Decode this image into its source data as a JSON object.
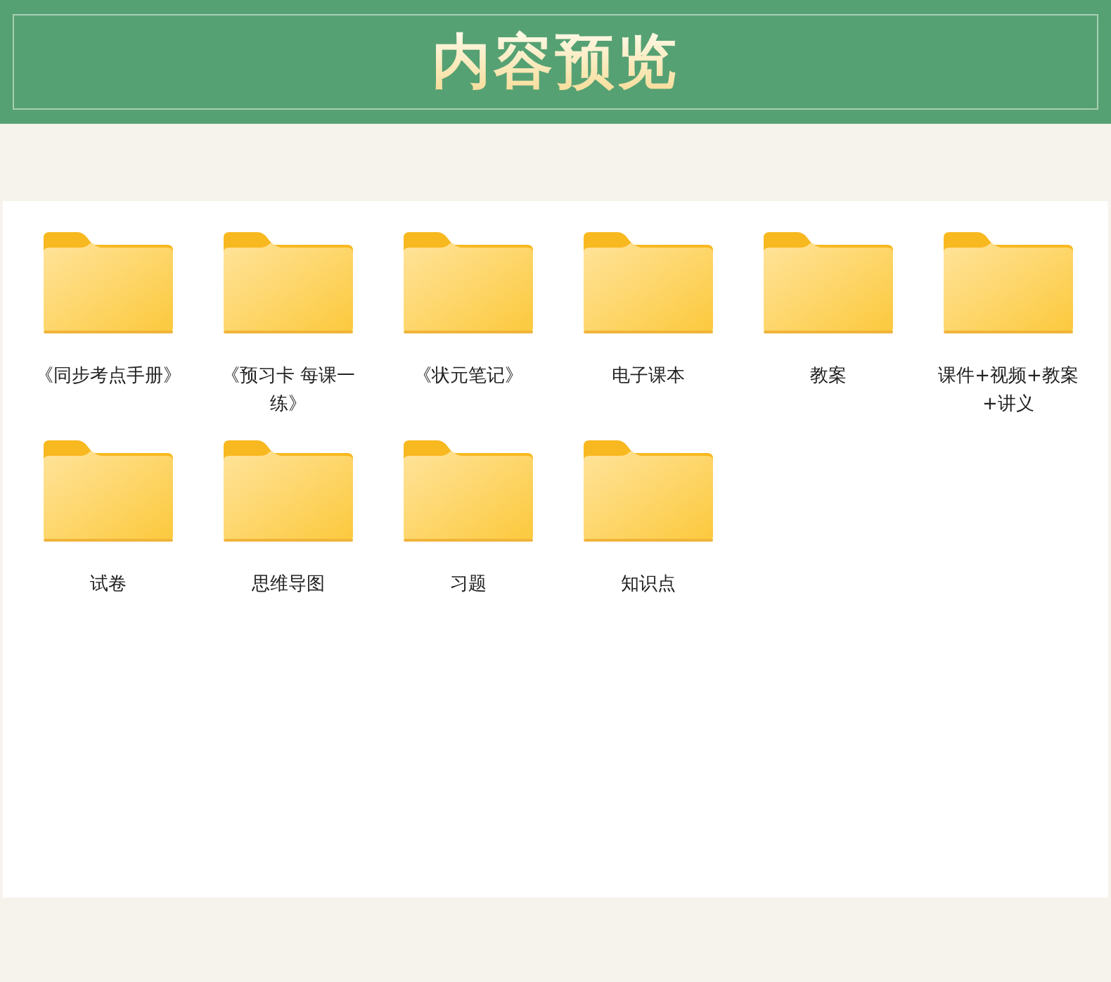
{
  "header": {
    "title": "内容预览"
  },
  "folders": [
    {
      "name": "《同步考点手册》"
    },
    {
      "name": "《预习卡 每课一练》"
    },
    {
      "name": "《状元笔记》"
    },
    {
      "name": "电子课本"
    },
    {
      "name": "教案"
    },
    {
      "name": "课件+视频+教案+讲义"
    },
    {
      "name": "试卷"
    },
    {
      "name": "思维导图"
    },
    {
      "name": "习题"
    },
    {
      "name": "知识点"
    }
  ]
}
